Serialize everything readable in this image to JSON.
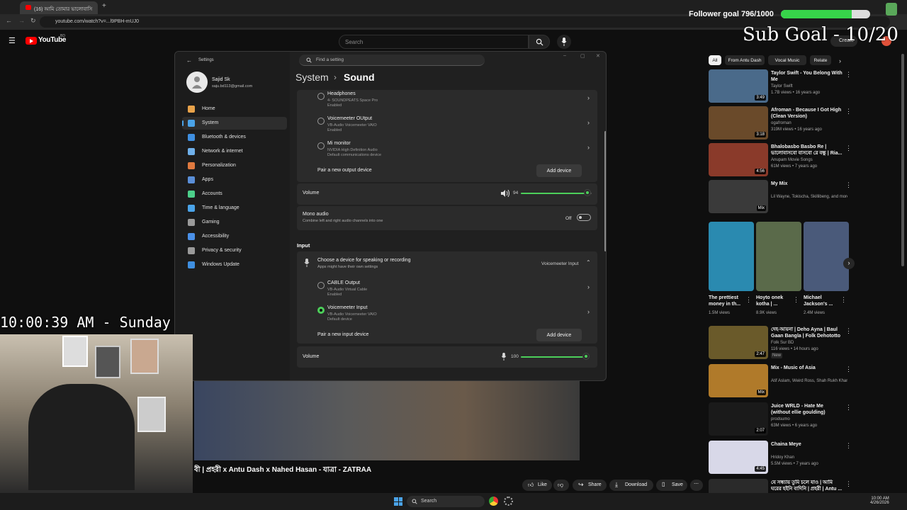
{
  "browser": {
    "tab_title": "(16) আমি তোমার ভালোবাসি",
    "url": "youtube.com/watch?v=...l9PBH-mUJ0"
  },
  "youtube": {
    "logo_text": "YouTube",
    "logo_sup": "BD",
    "search_placeholder": "Search",
    "create_label": "Create"
  },
  "overlay": {
    "follower_goal": "Follower goal 796/1000",
    "follower_progress": 0.796,
    "sub_goal": "Sub Goal - 10/20",
    "clock": "10:00:39 AM - Sunday",
    "kick_count": "5"
  },
  "settings": {
    "window_title": "Settings",
    "search_placeholder": "Find a setting",
    "user_name": "Sajid Sk",
    "user_email": "saju.bd113@gmail.com",
    "breadcrumb_parent": "System",
    "breadcrumb_sep": "›",
    "page_title": "Sound",
    "nav": [
      {
        "label": "Home",
        "color": "#e8a24a"
      },
      {
        "label": "System",
        "color": "#4aa3e8"
      },
      {
        "label": "Bluetooth & devices",
        "color": "#3f8fe0"
      },
      {
        "label": "Network & internet",
        "color": "#6fb0ea"
      },
      {
        "label": "Personalization",
        "color": "#e07a3f"
      },
      {
        "label": "Apps",
        "color": "#5a8fd8"
      },
      {
        "label": "Accounts",
        "color": "#4ccf8a"
      },
      {
        "label": "Time & language",
        "color": "#4aa3e8"
      },
      {
        "label": "Gaming",
        "color": "#9a9a9a"
      },
      {
        "label": "Accessibility",
        "color": "#4a90e8"
      },
      {
        "label": "Privacy & security",
        "color": "#9a9a9a"
      },
      {
        "label": "Windows Update",
        "color": "#3f8fe0"
      }
    ],
    "output_devices": [
      {
        "name": "Headphones",
        "sub1": "4- SOUNDPEATS Space Pro",
        "sub2": "Enabled",
        "selected": false
      },
      {
        "name": "Voicemeeter OUtput",
        "sub1": "VB-Audio Voicemeeter VAIO",
        "sub2": "Enabled",
        "selected": false
      },
      {
        "name": "Mi monitor",
        "sub1": "NVIDIA High Definition Audio",
        "sub2": "Default communications device",
        "selected": false
      }
    ],
    "pair_output_label": "Pair a new output device",
    "add_device_label": "Add device",
    "volume_label": "Volume",
    "output_volume": "94",
    "output_volume_level": 0.94,
    "mono_audio_title": "Mono audio",
    "mono_audio_sub": "Combine left and right audio channels into one",
    "mono_audio_state": "Off",
    "input_heading": "Input",
    "input_choose_title": "Choose a device for speaking or recording",
    "input_choose_sub": "Apps might have their own settings",
    "input_current": "Voicemeeter Input",
    "input_devices": [
      {
        "name": "CABLE Output",
        "sub1": "VB-Audio Virtual Cable",
        "sub2": "Enabled",
        "selected": false
      },
      {
        "name": "Voicemeeter Input",
        "sub1": "VB-Audio Voicemeeter VAIO",
        "sub2": "Default device",
        "selected": true
      }
    ],
    "pair_input_label": "Pair a new input device",
    "input_volume": "100",
    "input_volume_level": 1.0
  },
  "chips": [
    "All",
    "From Antu Dash",
    "Vocal Music",
    "Relate"
  ],
  "recs": [
    {
      "title": "Taylor Swift - You Belong With Me",
      "channel": "Taylor Swift",
      "meta": "1.7B views • 16 years ago",
      "duration": "3:49",
      "thumb": "#4a6a8a"
    },
    {
      "title": "Afroman - Because I Got High (Clean Version)",
      "channel": "ogafroman",
      "meta": "319M views • 16 years ago",
      "duration": "3:18",
      "thumb": "#6a4a2a"
    },
    {
      "title": "Bhalobasbo Basbo Re | ভালোবাসবো বাসবো রে বন্ধু | Ria...",
      "channel": "Anupam Movie Songs",
      "meta": "61M views • 7 years ago",
      "duration": "4:56",
      "thumb": "#8a3a2a"
    },
    {
      "title": "My Mix",
      "channel": "Lil Wayne, Tokischa, Skillibeng, and more",
      "meta": "",
      "duration": "Mix",
      "thumb": "#3a3a3a"
    }
  ],
  "shorts": [
    {
      "title": "The prettiest money in th...",
      "views": "1.5M views",
      "thumb": "#2a8ab0"
    },
    {
      "title": "Hoyto onek kotha | ...",
      "views": "8.9K views",
      "thumb": "#5a6a4a"
    },
    {
      "title": "Michael Jackson's ...",
      "views": "2.4M views",
      "thumb": "#4a5a7a"
    }
  ],
  "recs2": [
    {
      "title": "দেহ-আয়না | Deho Ayna | Baul Gaan Bangla | Folk Dehototto ...",
      "channel": "Folk Sur BD",
      "meta": "116 views • 14 hours ago",
      "badge": "New",
      "duration": "2:47",
      "thumb": "#6a5a2a"
    },
    {
      "title": "Mix - Music of Asia",
      "channel": "Atif Aslam, Weird Ross, Shah Rukh Khan, ...",
      "meta": "",
      "badge": "",
      "duration": "Mix",
      "thumb": "#b07a2a"
    },
    {
      "title": "Juice WRLD - Hate Me (without ellie goulding)",
      "channel": "prodsumo",
      "meta": "63M views • 6 years ago",
      "badge": "",
      "duration": "2:07",
      "thumb": "#1a1a1a"
    },
    {
      "title": "Chaina Meye",
      "channel": "Hridoy Khan",
      "meta": "5.5M views • 7 years ago",
      "badge": "",
      "duration": "4:45",
      "thumb": "#d8d8e8"
    },
    {
      "title": "যে সন্ধ্যায় তুমি চলে যাও | আমি ঘরের হইনি বাদিনি | প্রহরী | Antu ...",
      "channel": "",
      "meta": "",
      "badge": "",
      "duration": "",
      "thumb": "#2a2a2a"
    }
  ],
  "video": {
    "title": "বী | প্রহরী x Antu Dash x Nahed Hasan - যাত্রা - ZATRAA",
    "like_label": "Like",
    "share_label": "Share",
    "download_label": "Download",
    "save_label": "Save"
  },
  "taskbar": {
    "search_label": "Search",
    "time": "10:00 AM",
    "date": "4/26/2026"
  }
}
